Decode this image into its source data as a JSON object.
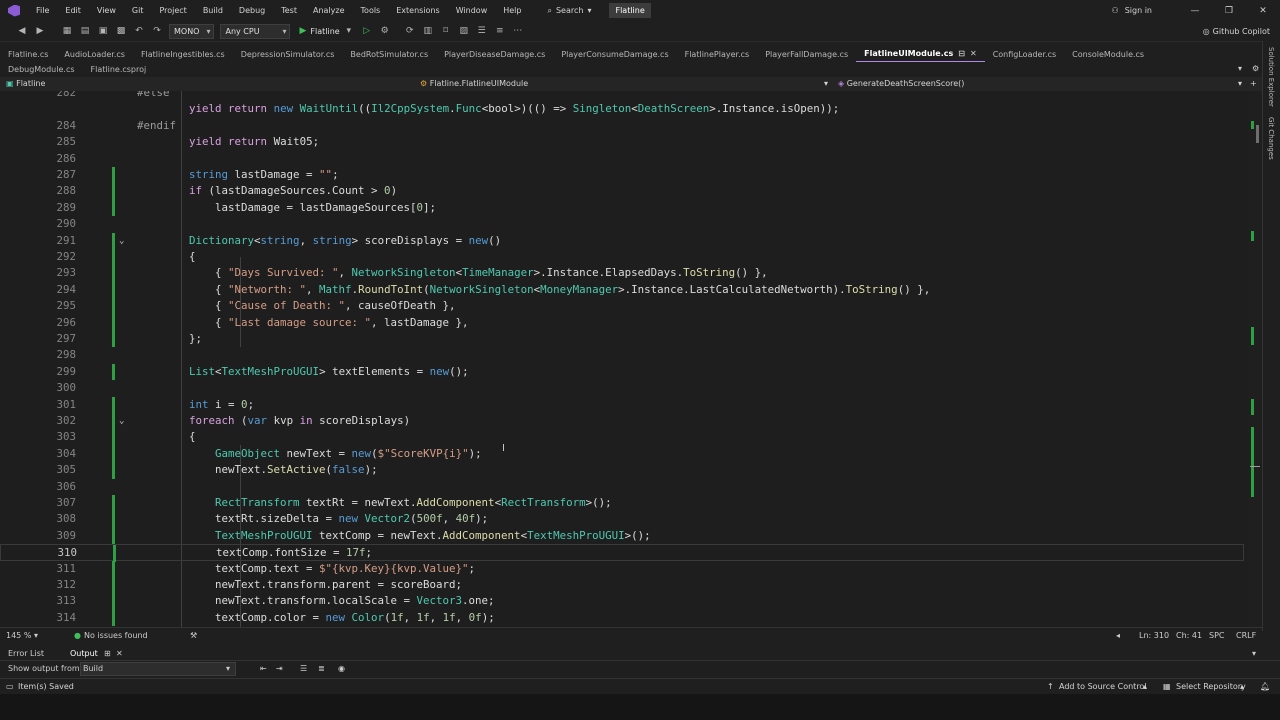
{
  "window": {
    "menu": [
      "File",
      "Edit",
      "View",
      "Git",
      "Project",
      "Build",
      "Debug",
      "Test",
      "Analyze",
      "Tools",
      "Extensions",
      "Window",
      "Help"
    ],
    "search_label": "Search",
    "project_badge": "Flatline",
    "sign_in": "Sign in"
  },
  "toolbar": {
    "config": "MONO",
    "platform": "Any CPU",
    "start_target": "Flatline",
    "copilot": "Github Copilot"
  },
  "tabs_row1": [
    {
      "label": "Flatline.cs",
      "active": false
    },
    {
      "label": "AudioLoader.cs",
      "active": false
    },
    {
      "label": "FlatlineIngestibles.cs",
      "active": false
    },
    {
      "label": "DepressionSimulator.cs",
      "active": false
    },
    {
      "label": "BedRotSimulator.cs",
      "active": false
    },
    {
      "label": "PlayerDiseaseDamage.cs",
      "active": false
    },
    {
      "label": "PlayerConsumeDamage.cs",
      "active": false
    },
    {
      "label": "FlatlinePlayer.cs",
      "active": false
    },
    {
      "label": "PlayerFallDamage.cs",
      "active": false
    },
    {
      "label": "FlatlineUIModule.cs",
      "active": true
    },
    {
      "label": "ConfigLoader.cs",
      "active": false
    },
    {
      "label": "ConsoleModule.cs",
      "active": false
    }
  ],
  "tabs_row2": [
    {
      "label": "DebugModule.cs"
    },
    {
      "label": "Flatline.csproj"
    }
  ],
  "navbar": {
    "project": "Flatline",
    "class": "Flatline.FlatlineUIModule",
    "member": "GenerateDeathScreenScore()"
  },
  "code": {
    "current_line": 310,
    "lines": [
      {
        "n": "282",
        "text": "#else"
      },
      {
        "n": "",
        "text": "        yield return new WaitUntil((Il2CppSystem.Func<bool>)(() => Singleton<DeathScreen>.Instance.isOpen));"
      },
      {
        "n": "284",
        "text": "#endif"
      },
      {
        "n": "285",
        "text": "        yield return Wait05;"
      },
      {
        "n": "286",
        "text": ""
      },
      {
        "n": "287",
        "text": "        string lastDamage = \"\";"
      },
      {
        "n": "288",
        "text": "        if (lastDamageSources.Count > 0)"
      },
      {
        "n": "289",
        "text": "            lastDamage = lastDamageSources[0];"
      },
      {
        "n": "290",
        "text": ""
      },
      {
        "n": "291",
        "text": "        Dictionary<string, string> scoreDisplays = new()"
      },
      {
        "n": "292",
        "text": "        {"
      },
      {
        "n": "293",
        "text": "            { \"Days Survived: \", NetworkSingleton<TimeManager>.Instance.ElapsedDays.ToString() },"
      },
      {
        "n": "294",
        "text": "            { \"Networth: \", Mathf.RoundToInt(NetworkSingleton<MoneyManager>.Instance.LastCalculatedNetworth).ToString() },"
      },
      {
        "n": "295",
        "text": "            { \"Cause of Death: \", causeOfDeath },"
      },
      {
        "n": "296",
        "text": "            { \"Last damage source: \", lastDamage },"
      },
      {
        "n": "297",
        "text": "        };"
      },
      {
        "n": "298",
        "text": ""
      },
      {
        "n": "299",
        "text": "        List<TextMeshProUGUI> textElements = new();"
      },
      {
        "n": "300",
        "text": ""
      },
      {
        "n": "301",
        "text": "        int i = 0;"
      },
      {
        "n": "302",
        "text": "        foreach (var kvp in scoreDisplays)"
      },
      {
        "n": "303",
        "text": "        {"
      },
      {
        "n": "304",
        "text": "            GameObject newText = new($\"ScoreKVP{i}\");"
      },
      {
        "n": "305",
        "text": "            newText.SetActive(false);"
      },
      {
        "n": "306",
        "text": ""
      },
      {
        "n": "307",
        "text": "            RectTransform textRt = newText.AddComponent<RectTransform>();"
      },
      {
        "n": "308",
        "text": "            textRt.sizeDelta = new Vector2(500f, 40f);"
      },
      {
        "n": "309",
        "text": "            TextMeshProUGUI textComp = newText.AddComponent<TextMeshProUGUI>();"
      },
      {
        "n": "310",
        "text": "            textComp.fontSize = 17f;"
      },
      {
        "n": "311",
        "text": "            textComp.text = $\"{kvp.Key}{kvp.Value}\";"
      },
      {
        "n": "312",
        "text": "            newText.transform.parent = scoreBoard;"
      },
      {
        "n": "313",
        "text": "            newText.transform.localScale = Vector3.one;"
      },
      {
        "n": "314",
        "text": "            textComp.color = new Color(1f, 1f, 1f, 0f);"
      }
    ]
  },
  "editor_status": {
    "zoom": "145 %",
    "issues": "No issues found",
    "position": "Ln: 310",
    "column": "Ch: 41",
    "spacing": "SPC",
    "eol": "CRLF"
  },
  "output": {
    "tabs": [
      "Error List",
      "Output"
    ],
    "show_from_label": "Show output from:",
    "show_from_value": "Build"
  },
  "statusbar": {
    "message": "Item(s) Saved",
    "source_control": "Add to Source Control",
    "repository": "Select Repository"
  },
  "side_panel": [
    "Solution Explorer",
    "Git Changes"
  ],
  "colors": {
    "accent": "#b187e8",
    "change_marker": "#2ea043",
    "keyword": "#569cd6",
    "type": "#4ec9b0",
    "string": "#d69d85",
    "method": "#dcdcaa"
  }
}
